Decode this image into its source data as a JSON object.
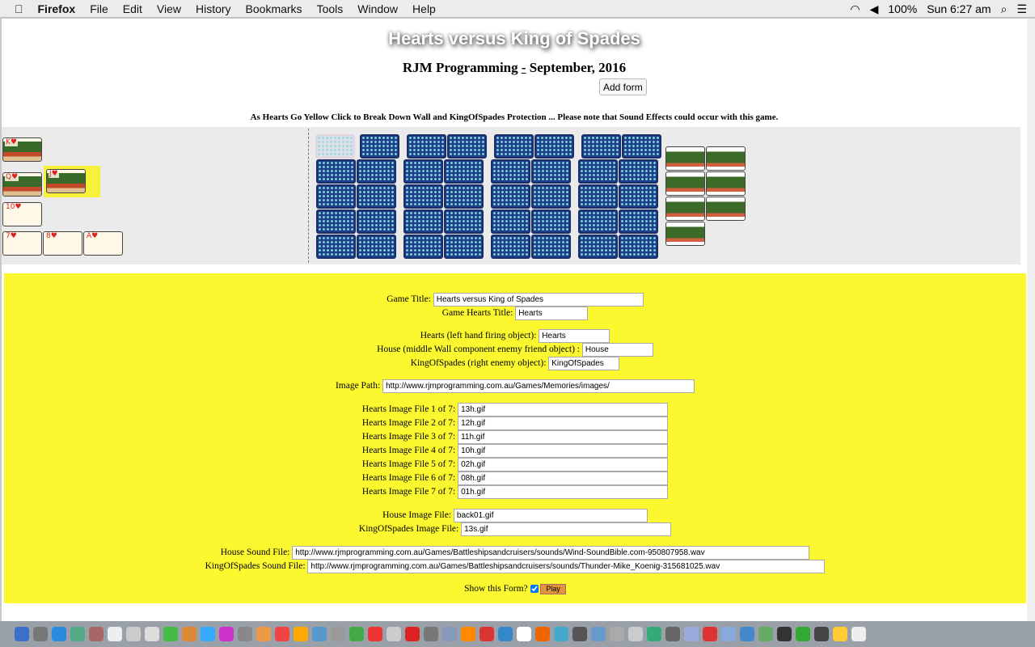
{
  "menubar": {
    "apple": "",
    "app": "Firefox",
    "items": [
      "File",
      "Edit",
      "View",
      "History",
      "Bookmarks",
      "Tools",
      "Window",
      "Help"
    ],
    "battery": "100%",
    "clock": "Sun 6:27 am"
  },
  "page": {
    "title": "Hearts versus King of Spades",
    "subtitle_a": "RJM Programming ",
    "subtitle_dash": "-",
    "subtitle_b": " September, 2016",
    "add_form": "Add form",
    "instructions": "As Hearts Go Yellow Click to Break Down Wall and KingOfSpades Protection ... Please note that Sound Effects could occur with this game."
  },
  "game": {
    "hearts": [
      "K♥",
      "Q♥",
      "J♥",
      "10♥",
      "7♥",
      "8♥",
      "A♥"
    ],
    "highlight_color": "#f7f13a"
  },
  "form": {
    "fields": [
      {
        "label": "Game Title:",
        "value": "Hearts versus King of Spades"
      },
      {
        "label": "Game Hearts Title:",
        "value": "Hearts"
      },
      {
        "label": "Hearts (left hand firing object):",
        "value": "Hearts"
      },
      {
        "label": "House (middle Wall component enemy friend object) :",
        "value": "House"
      },
      {
        "label": "KingOfSpades (right enemy object):",
        "value": "KingOfSpades"
      },
      {
        "label": "Image Path:",
        "value": "http://www.rjmprogramming.com.au/Games/Memories/images/"
      },
      {
        "label": "Hearts Image File 1 of 7:",
        "value": "13h.gif"
      },
      {
        "label": "Hearts Image File 2 of 7:",
        "value": "12h.gif"
      },
      {
        "label": "Hearts Image File 3 of 7:",
        "value": "11h.gif"
      },
      {
        "label": "Hearts Image File 4 of 7:",
        "value": "10h.gif"
      },
      {
        "label": "Hearts Image File 5 of 7:",
        "value": "02h.gif"
      },
      {
        "label": "Hearts Image File 6 of 7:",
        "value": "08h.gif"
      },
      {
        "label": "Hearts Image File 7 of 7:",
        "value": "01h.gif"
      },
      {
        "label": "House Image File:",
        "value": "back01.gif"
      },
      {
        "label": "KingOfSpades Image File:",
        "value": "13s.gif"
      },
      {
        "label": "House Sound File:",
        "value": "http://www.rjmprogramming.com.au/Games/Battleshipsandcruisers/sounds/Wind-SoundBible.com-950807958.wav"
      },
      {
        "label": "KingOfSpades Sound File:",
        "value": "http://www.rjmprogramming.com.au/Games/Battleshipsandcruisers/sounds/Thunder-Mike_Koenig-315681025.wav"
      }
    ],
    "show_label": "Show this Form?",
    "show_checked": true,
    "play": "Play",
    "bg_color": "#fcf82f"
  }
}
